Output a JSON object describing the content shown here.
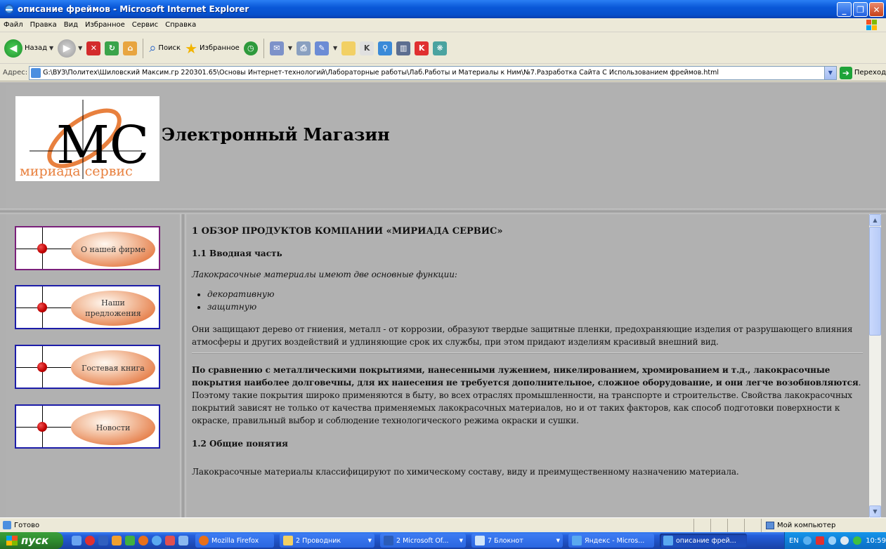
{
  "window": {
    "title": "описание фреймов - Microsoft Internet Explorer"
  },
  "menu": [
    "Файл",
    "Правка",
    "Вид",
    "Избранное",
    "Сервис",
    "Справка"
  ],
  "toolbar": {
    "back": "Назад",
    "search": "Поиск",
    "favorites": "Избранное"
  },
  "address": {
    "label": "Адрес:",
    "value": "G:\\ВУЗ\\Политех\\Шиловский Максим.гр 220301.65\\Основы Интернет-технологий\\Лабораторные работы\\Лаб.Работы и Материалы к Ним\\№7.Разработка Сайта С Использованием фреймов.html",
    "go": "Переход"
  },
  "site": {
    "title": "Электронный Магазин",
    "logo_text": "мириада сервис",
    "logo_letters": "МС"
  },
  "nav": [
    {
      "label": "О нашей фирме"
    },
    {
      "label": "Наши предложения"
    },
    {
      "label": "Гостевая книга"
    },
    {
      "label": "Новости"
    }
  ],
  "article": {
    "heading": "1 ОБЗОР ПРОДУКТОВ КОМПАНИИ «МИРИАДА СЕРВИС»",
    "sub1": "1.1 Вводная часть",
    "intro": "Лакокрасочные материалы имеют две основные функции:",
    "bullets": [
      "декоративную",
      "защитную"
    ],
    "p1": "Они защищают дерево от гниения, металл - от коррозии, образуют твердые защитные пленки, предохраняющие изделия от разрушающего влияния атмосферы и других воздействий и удлиняющие срок их службы, при этом придают изделиям красивый внешний вид.",
    "p2_bold": "По сравнению с металлическими покрытиями, нанесенными лужением, никелированием, хромированием и т.д., лакокрасочные покрытия наиболее долговечны, для их нанесения не требуется дополнительное, сложное оборудование, и они легче возобновляются",
    "p2_rest": ". Поэтому такие покрытия широко применяются в быту, во всех отраслях промышленности, на транспорте и строительстве. Свойства лакокрасочных покрытий зависят не только от качества применяемых лакокрасочных материалов, но и от таких факторов, как способ подготовки поверхности к окраске, правильный выбор и соблюдение технологического режима окраски и сушки.",
    "sub2": "1.2 Общие понятия",
    "p3": "Лакокрасочные материалы классифицируют по химическому составу, виду и преимущественному назначению материала."
  },
  "status": {
    "text": "Готово",
    "zone": "Мой компьютер"
  },
  "taskbar": {
    "start": "пуск",
    "tasks": [
      "Mozilla Firefox",
      "2 Проводник",
      "2 Microsoft Of...",
      "7 Блокнот",
      "Яндекс - Micros...",
      "описание фрей..."
    ],
    "lang": "EN",
    "clock": "10:59"
  },
  "colors": {
    "titlebar": "#0a58d8",
    "frame_bg": "#b1b1b1",
    "nav_border": "#1c1ca8",
    "nav_first_border": "#7a1f7a",
    "button_orange": "#e57b45"
  }
}
